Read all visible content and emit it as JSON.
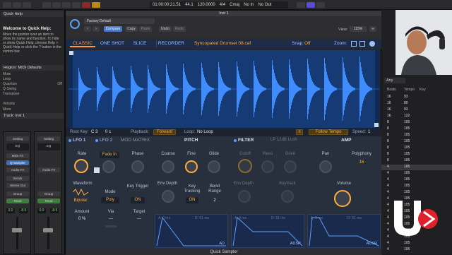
{
  "transport": {
    "position": "01:00:00:21.51",
    "tempo": "44.1",
    "bars": "120.0000",
    "signature": "4/4",
    "key": "Cmaj",
    "in_label": "No In",
    "out_label": "No Out"
  },
  "quick_help": {
    "title": "Quick Help",
    "welcome": "Welcome to Quick Help:",
    "text": "Move the pointer over an item to show its name and function. To hide or show Quick Help, choose Help > Quick Help or click the ? button in the control bar."
  },
  "inspector": {
    "region_header": "Region: MIDI Defaults",
    "mute_label": "Mute",
    "loop_label": "Loop",
    "quantize_label": "Quantize",
    "quantize_value": "Off",
    "q_swing_label": "Q-Swing",
    "transpose_label": "Transpose",
    "velocity_label": "Velocity",
    "more_label": "More",
    "track_header": "Track: Inst 1"
  },
  "strips": [
    {
      "setting": "Setting",
      "eq": "EQ",
      "midi_fx": "MIDI FX",
      "instrument": "Q-Sampler",
      "audio_fx": "Audio FX",
      "send": "Sends",
      "output": "Stereo Out",
      "group": "Group",
      "mode": "Read",
      "vol": "0.0",
      "pan": "-8.5",
      "name": "Inst 1"
    },
    {
      "setting": "Setting",
      "eq": "EQ",
      "midi_fx": "",
      "instrument": "",
      "audio_fx": "Audio FX",
      "send": "",
      "output": "",
      "group": "Group",
      "mode": "Read",
      "vol": "0.0",
      "pan": "-8.5",
      "name": "Stereo Out"
    }
  ],
  "plugin": {
    "window_title": "Inst 1",
    "preset": "Factory Default",
    "compare": "Compare",
    "copy": "Copy",
    "paste": "Paste",
    "undo": "Undo",
    "redo": "Redo",
    "view_label": "View:",
    "view_value": "115%",
    "footer": "Quick Sampler"
  },
  "modes": {
    "classic": "CLASSIC",
    "one_shot": "ONE SHOT",
    "slice": "SLICE",
    "recorder": "RECORDER",
    "sample_name": "Syncopated Drumset 08.caf",
    "snap_label": "Snap:",
    "snap_value": "Off",
    "zoom_label": "Zoom:"
  },
  "sample_bar": {
    "root_key_label": "Root Key:",
    "root_key_value": "C 3",
    "fine_value": "0 c",
    "playback_label": "Playback:",
    "playback_value": "Forward",
    "loop_label": "Loop:",
    "loop_value": "No Loop",
    "follow_tempo": "Follow Tempo",
    "speed_label": "Speed:",
    "speed_value": "1"
  },
  "lfo": {
    "tab1": "LFO 1",
    "tab2": "LFO 2",
    "tab3": "MOD MATRIX",
    "rate_label": "Rate",
    "fade_label": "Fade In",
    "phase_label": "Phase",
    "waveform_label": "Waveform",
    "waveform_value": "Bipolar",
    "mode_label": "Mode",
    "mode_value": "Poly",
    "key_trigger_label": "Key Trigger",
    "key_trigger_value": "ON",
    "amount_label": "Amount",
    "amount_value": "0 %",
    "via_label": "Via",
    "via_value": "—",
    "target_label": "Target",
    "target_value": "—"
  },
  "pitch": {
    "title": "PITCH",
    "coarse_label": "Coarse",
    "fine_label": "Fine",
    "glide_label": "Glide",
    "env_depth_label": "Env Depth",
    "key_tracking_label": "Key Tracking",
    "key_tracking_value": "ON",
    "bend_range_label": "Bend Range",
    "bend_range_value": "2"
  },
  "filter": {
    "title": "FILTER",
    "type_value": "LP 12dB Lush",
    "cutoff_label": "Cutoff",
    "reso_label": "Reso",
    "drive_label": "Drive",
    "env_depth_label": "Env Depth",
    "keytrack_label": "Keytrack"
  },
  "amp": {
    "title": "AMP",
    "pan_label": "Pan",
    "polyphony_label": "Polyphony",
    "polyphony_value": "16",
    "volume_label": "Volume"
  },
  "env": {
    "pitch_label": "AD",
    "filter_label": "ADSR",
    "amp_label": "ADSR",
    "a_label": "A: 0 ms",
    "d_label": "D: 51 ms"
  },
  "right_panel": {
    "any_label": "Any",
    "headers": [
      "Beats",
      "Tempo",
      "Key"
    ],
    "rows": [
      {
        "beats": "16",
        "tempo": "93"
      },
      {
        "beats": "16",
        "tempo": "80"
      },
      {
        "beats": "16",
        "tempo": "93"
      },
      {
        "beats": "16",
        "tempo": "122"
      },
      {
        "beats": "8",
        "tempo": "105"
      },
      {
        "beats": "8",
        "tempo": "105"
      },
      {
        "beats": "8",
        "tempo": "105"
      },
      {
        "beats": "8",
        "tempo": "105"
      },
      {
        "beats": "8",
        "tempo": "105"
      },
      {
        "beats": "8",
        "tempo": "105"
      },
      {
        "beats": "8",
        "tempo": "105"
      },
      {
        "beats": "4",
        "tempo": "105"
      },
      {
        "beats": "4",
        "tempo": "105"
      },
      {
        "beats": "4",
        "tempo": "105"
      },
      {
        "beats": "4",
        "tempo": "105"
      },
      {
        "beats": "4",
        "tempo": "105"
      },
      {
        "beats": "4",
        "tempo": "105"
      },
      {
        "beats": "4",
        "tempo": "105"
      },
      {
        "beats": "4",
        "tempo": "105"
      },
      {
        "beats": "4",
        "tempo": "105"
      },
      {
        "beats": "4",
        "tempo": "105"
      },
      {
        "beats": "4",
        "tempo": "105"
      },
      {
        "beats": "4",
        "tempo": "105"
      },
      {
        "beats": "4",
        "tempo": "105"
      },
      {
        "beats": "4",
        "tempo": "105"
      }
    ]
  },
  "colors": {
    "accent_orange": "#ffae3a",
    "wave_blue": "#2f7bea",
    "panel_bg": "#28303d"
  }
}
